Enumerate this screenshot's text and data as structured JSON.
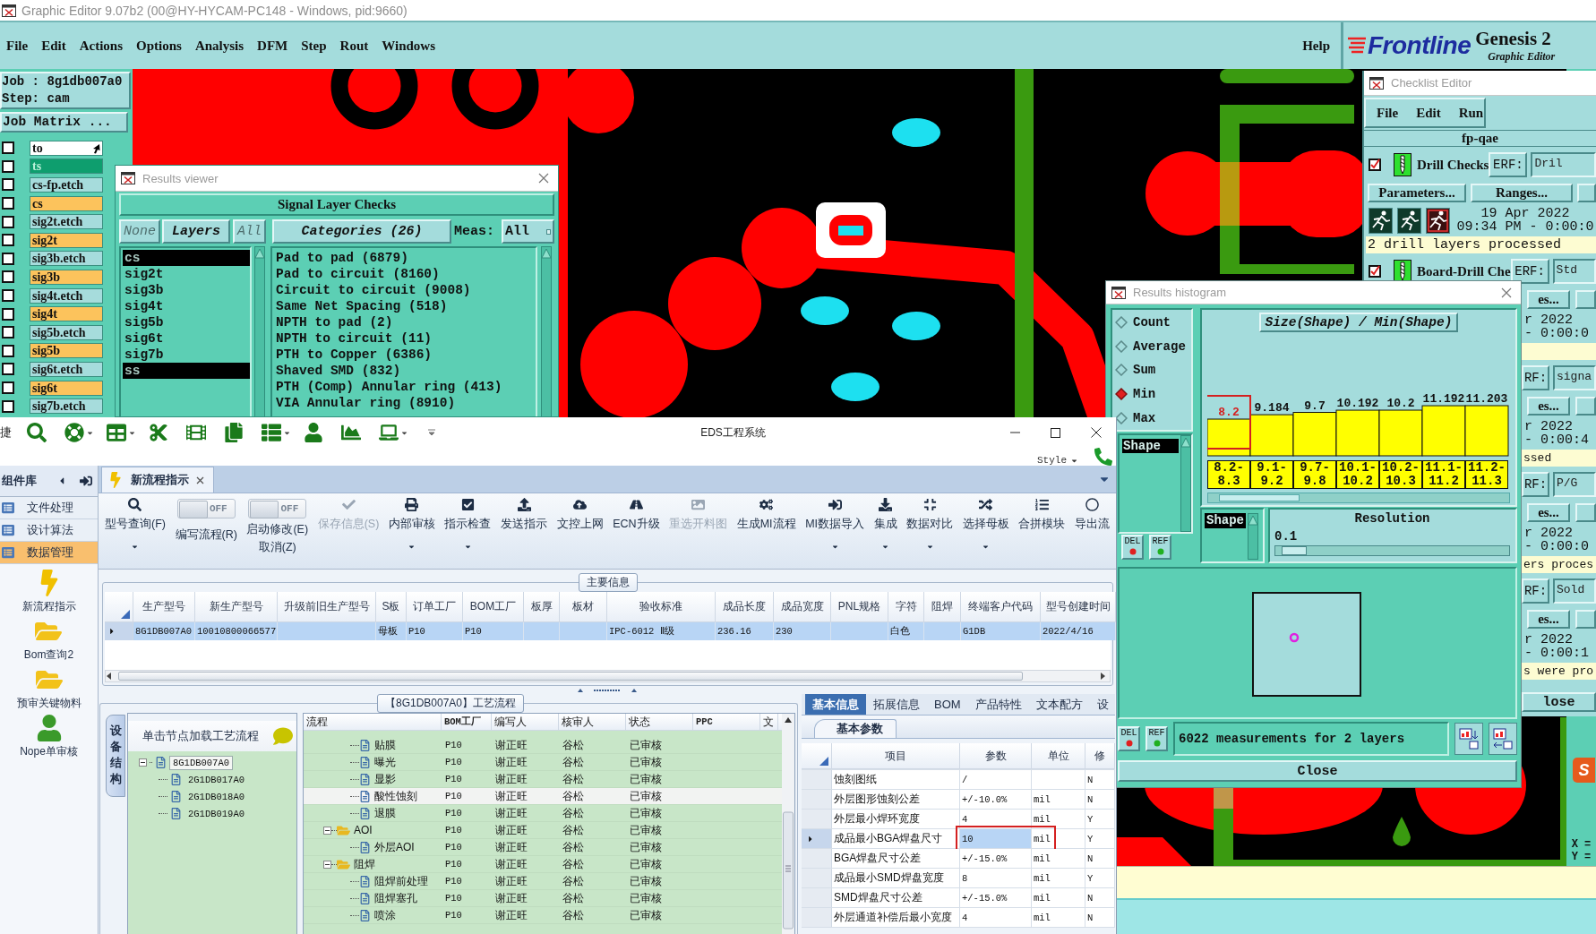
{
  "genesis": {
    "title": "Graphic Editor 9.07b2 (00@HY-HYCAM-PC148 - Windows, pid:9660)",
    "menu": [
      "File",
      "Edit",
      "Actions",
      "Options",
      "Analysis",
      "DFM",
      "Step",
      "Rout",
      "Windows"
    ],
    "help": "Help",
    "logo": {
      "brand": "Frontline",
      "product": "Genesis 2",
      "subtitle": "Graphic Editor"
    },
    "job": "Job : 8g1db007a0",
    "step": "Step: cam",
    "job_matrix": "Job Matrix ...",
    "layers": [
      {
        "name": "to",
        "color": "#ffffff",
        "checked": false,
        "pointer": true
      },
      {
        "name": "ts",
        "color": "#0e9e6e",
        "checked": false,
        "pointer": false
      },
      {
        "name": "cs-fp.etch",
        "color": "#a6dcdc",
        "checked": false,
        "pointer": false
      },
      {
        "name": "cs",
        "color": "#fcc35c",
        "checked": false,
        "pointer": false
      },
      {
        "name": "sig2t.etch",
        "color": "#a6dcdc",
        "checked": false,
        "pointer": false
      },
      {
        "name": "sig2t",
        "color": "#fcc35c",
        "checked": false,
        "pointer": false
      },
      {
        "name": "sig3b.etch",
        "color": "#a6dcdc",
        "checked": false,
        "pointer": false
      },
      {
        "name": "sig3b",
        "color": "#fcc35c",
        "checked": false,
        "pointer": false
      },
      {
        "name": "sig4t.etch",
        "color": "#a6dcdc",
        "checked": false,
        "pointer": false
      },
      {
        "name": "sig4t",
        "color": "#fcc35c",
        "checked": false,
        "pointer": false
      },
      {
        "name": "sig5b.etch",
        "color": "#a6dcdc",
        "checked": false,
        "pointer": false
      },
      {
        "name": "sig5b",
        "color": "#fcc35c",
        "checked": false,
        "pointer": false
      },
      {
        "name": "sig6t.etch",
        "color": "#a6dcdc",
        "checked": false,
        "pointer": false
      },
      {
        "name": "sig6t",
        "color": "#fcc35c",
        "checked": false,
        "pointer": false
      },
      {
        "name": "sig7b.etch",
        "color": "#a6dcdc",
        "checked": false,
        "pointer": false
      }
    ],
    "badge": "S",
    "coords": [
      "X =",
      "Y ="
    ]
  },
  "results_viewer": {
    "title": "Results viewer",
    "header": "Signal Layer Checks",
    "none": "None",
    "layers_title": "Layers",
    "all": "All",
    "categories_title": "Categories (26)",
    "meas_label": "Meas:",
    "meas_value": "All",
    "layers": [
      {
        "name": "cs",
        "selected": true
      },
      {
        "name": "sig2t",
        "selected": false
      },
      {
        "name": "sig3b",
        "selected": false
      },
      {
        "name": "sig4t",
        "selected": false
      },
      {
        "name": "sig5b",
        "selected": false
      },
      {
        "name": "sig6t",
        "selected": false
      },
      {
        "name": "sig7b",
        "selected": false
      },
      {
        "name": "ss",
        "selected": true
      }
    ],
    "categories": [
      {
        "label": "Pad to pad (6879)",
        "selected": false
      },
      {
        "label": "Pad to circuit (8160)",
        "selected": false
      },
      {
        "label": "Circuit to circuit (9008)",
        "selected": false
      },
      {
        "label": "Same Net Spacing (518)",
        "selected": false
      },
      {
        "label": "NPTH to pad (2)",
        "selected": false
      },
      {
        "label": "NPTH to circuit (11)",
        "selected": false
      },
      {
        "label": "PTH to Copper (6386)",
        "selected": false
      },
      {
        "label": "Shaved SMD (832)",
        "selected": false
      },
      {
        "label": "PTH (Comp) Annular ring (413)",
        "selected": false
      },
      {
        "label": "VIA Annular ring (8910)",
        "selected": false
      }
    ]
  },
  "checklist": {
    "title": "Checklist Editor",
    "menu": [
      "File",
      "Edit",
      "Run"
    ],
    "name": "fp-qae",
    "checks": [
      {
        "kind": "full",
        "checked": true,
        "name": "Drill Checks",
        "erf_label": "ERF:",
        "erf": "Dril",
        "parameters": "Parameters...",
        "ranges": "Ranges...",
        "date": "19 Apr 2022",
        "time": "09:34 PM - 0:00:0",
        "status": "2 drill layers processed"
      },
      {
        "kind": "header",
        "checked": true,
        "name": "Board-Drill Che",
        "erf_label": "ERF:",
        "erf": "Std",
        "ranges": "es...",
        "date": "r 2022",
        "time": "- 0:00:0"
      },
      {
        "kind": "strip",
        "erf_label": "RF:",
        "erf": "signa",
        "ranges": "es...",
        "date": "r 2022",
        "time": "- 0:00:4",
        "status": "ssed"
      },
      {
        "kind": "strip",
        "erf_label": "RF:",
        "erf": "P/G",
        "ranges": "es...",
        "date": "r 2022",
        "time": "- 0:00:0",
        "status": "ers proces"
      },
      {
        "kind": "strip",
        "erf_label": "RF:",
        "erf": "Sold",
        "ranges": "es...",
        "date": "r 2022",
        "time": "- 0:00:1",
        "status": "s were pro"
      }
    ],
    "close": "lose"
  },
  "histogram": {
    "title": "Results histogram",
    "modes": [
      {
        "label": "Count",
        "selected": false
      },
      {
        "label": "Average",
        "selected": false
      },
      {
        "label": "Sum",
        "selected": false
      },
      {
        "label": "Min",
        "selected": true
      },
      {
        "label": "Max",
        "selected": false
      }
    ],
    "fields": [
      {
        "label": "Shape",
        "selected": true
      }
    ],
    "top_buttons": [
      "DEL",
      "REF"
    ],
    "chart_data": {
      "type": "bar",
      "title": "Size(Shape) / Min(Shape)",
      "categories": [
        "8.2-8.3",
        "9.1-9.2",
        "9.7-9.8",
        "10.1-10.2",
        "10.2-10.3",
        "11.1-11.2",
        "11.2-11.3"
      ],
      "values": [
        8.2,
        9.184,
        9.7,
        10.192,
        10.2,
        11.192,
        11.203
      ],
      "data_labels": true
    },
    "bins": [
      {
        "highlighted": true
      },
      {
        "highlighted": false
      },
      {
        "highlighted": false
      },
      {
        "highlighted": false
      },
      {
        "highlighted": false
      },
      {
        "highlighted": false
      },
      {
        "highlighted": false
      }
    ],
    "field_label": "Shape",
    "resolution_label": "Resolution",
    "resolution": "0.1",
    "resolution_slider": {
      "level": 0.03
    },
    "bottom_buttons": [
      "DEL",
      "REF"
    ],
    "summary": "6022 measurements for 2 layers",
    "close": "Close"
  },
  "eds": {
    "quick_label": "捷",
    "title": "EDS工程系统",
    "style": "Style",
    "sidebar": {
      "title": "组件库",
      "groups": [
        {
          "label": "文件处理",
          "selected": false
        },
        {
          "label": "设计算法",
          "selected": false
        },
        {
          "label": "数据管理",
          "selected": true
        }
      ],
      "items": [
        {
          "label": "新流程指示"
        },
        {
          "label": "Bom查询2"
        },
        {
          "label": "预审关键物料"
        },
        {
          "label": "Nope单审核"
        }
      ]
    },
    "tabs": [
      {
        "label": "新流程指示",
        "selected": true
      }
    ],
    "ribbon": [
      {
        "kind": "button",
        "label": "型号查询(F)",
        "disabled": false,
        "dropdown": true
      },
      {
        "kind": "toggle",
        "toggle": "OFF",
        "on": false,
        "label": "编写流程(R)"
      },
      {
        "kind": "toggle",
        "toggle": "OFF",
        "on": false,
        "label": "启动修改(E)",
        "label2": "取消(Z)"
      },
      {
        "kind": "button",
        "label": "保存信息(S)",
        "disabled": true,
        "dropdown": false
      },
      {
        "kind": "button",
        "label": "内部审核",
        "disabled": false,
        "dropdown": true
      },
      {
        "kind": "button",
        "label": "指示检查",
        "disabled": false,
        "dropdown": true
      },
      {
        "kind": "button",
        "label": "发送指示",
        "disabled": false,
        "dropdown": false
      },
      {
        "kind": "button",
        "label": "文控上网",
        "disabled": false,
        "dropdown": false
      },
      {
        "kind": "button",
        "label": "ECN升级",
        "disabled": false,
        "dropdown": false
      },
      {
        "kind": "button",
        "label": "重选开料图",
        "disabled": true,
        "dropdown": false
      },
      {
        "kind": "button",
        "label": "生成MI流程",
        "disabled": false,
        "dropdown": false
      },
      {
        "kind": "button",
        "label": "MI数据导入",
        "disabled": false,
        "dropdown": true
      },
      {
        "kind": "button",
        "label": "集成",
        "disabled": false,
        "dropdown": true
      },
      {
        "kind": "button",
        "label": "数据对比",
        "disabled": false,
        "dropdown": true
      },
      {
        "kind": "button",
        "label": "选择母板",
        "disabled": false,
        "dropdown": true
      },
      {
        "kind": "button",
        "label": "合拼模块",
        "disabled": false,
        "dropdown": false
      },
      {
        "kind": "button",
        "label": "导出流",
        "disabled": false,
        "dropdown": false
      }
    ],
    "main_info": {
      "title": "主要信息",
      "columns": [
        "生产型号",
        "新生产型号",
        "升级前旧生产型号",
        "S板",
        "订单工厂",
        "BOM工厂",
        "板厚",
        "板材",
        "验收标准",
        "成品长度",
        "成品宽度",
        "PNL规格",
        "字符",
        "阻焊",
        "终端客户代码",
        "型号创建时间"
      ],
      "rows": [
        {
          "selected": true,
          "cells": [
            "8G1DB007A0",
            "10010800066577",
            null,
            "母板",
            "P10",
            "P10",
            null,
            null,
            "IPC-6012 Ⅱ级",
            "236.16",
            "230",
            null,
            "白色",
            null,
            "G1DB",
            "2022/4/16"
          ]
        }
      ]
    },
    "process": {
      "title": "【8G1DB007A0】工艺流程",
      "side_tab": "设备结构",
      "tree_header": "单击节点加载工艺流程",
      "tree": [
        {
          "label": "8G1DB007A0",
          "expanded": true,
          "selected": true,
          "children": [
            {
              "label": "2G1DB017A0",
              "selected": false
            },
            {
              "label": "2G1DB018A0",
              "selected": false
            },
            {
              "label": "2G1DB019A0",
              "selected": false
            }
          ]
        }
      ],
      "columns": [
        "流程",
        "BOM工厂",
        "编写人",
        "核审人",
        "状态",
        "PPC",
        "文"
      ],
      "rows": [
        {
          "children": [
            {
              "kind": "step",
              "label": "贴膜",
              "cells": [
                "P10",
                "谢正旺",
                "谷松",
                "已审核"
              ],
              "selected": false
            },
            {
              "kind": "step",
              "label": "曝光",
              "cells": [
                "P10",
                "谢正旺",
                "谷松",
                "已审核"
              ],
              "selected": false
            },
            {
              "kind": "step",
              "label": "显影",
              "cells": [
                "P10",
                "谢正旺",
                "谷松",
                "已审核"
              ],
              "selected": false
            },
            {
              "kind": "step",
              "label": "酸性蚀刻",
              "cells": [
                "P10",
                "谢正旺",
                "谷松",
                "已审核"
              ],
              "selected": true
            },
            {
              "kind": "step",
              "label": "退膜",
              "cells": [
                "P10",
                "谢正旺",
                "谷松",
                "已审核"
              ],
              "selected": false
            }
          ]
        },
        {
          "kind": "folder",
          "label": "AOI",
          "expanded": true,
          "selected": false,
          "cells": [
            "P10",
            "谢正旺",
            "谷松",
            "已审核"
          ],
          "children": [
            {
              "kind": "step",
              "label": "外层AOI",
              "cells": [
                "P10",
                "谢正旺",
                "谷松",
                "已审核"
              ],
              "selected": false
            }
          ]
        },
        {
          "kind": "folder",
          "label": "阻焊",
          "expanded": true,
          "selected": false,
          "cells": [
            "P10",
            "谢正旺",
            "谷松",
            "已审核"
          ],
          "children": [
            {
              "kind": "step",
              "label": "阻焊前处理",
              "cells": [
                "P10",
                "谢正旺",
                "谷松",
                "已审核"
              ],
              "selected": false
            },
            {
              "kind": "step",
              "label": "阻焊塞孔",
              "cells": [
                "P10",
                "谢正旺",
                "谷松",
                "已审核"
              ],
              "selected": false
            },
            {
              "kind": "step",
              "label": "喷涂",
              "cells": [
                "P10",
                "谢正旺",
                "谷松",
                "已审核"
              ],
              "selected": false
            }
          ]
        }
      ]
    },
    "params": {
      "tabs": [
        {
          "label": "基本信息",
          "selected": true
        },
        {
          "label": "拓展信息",
          "selected": false
        },
        {
          "label": "BOM",
          "selected": false
        },
        {
          "label": "产品特性",
          "selected": false
        },
        {
          "label": "文本配方",
          "selected": false
        },
        {
          "label": "设",
          "selected": false
        }
      ],
      "subtab": "基本参数",
      "columns": [
        "项目",
        "参数",
        "单位",
        "修"
      ],
      "rows": [
        {
          "cells": [
            "蚀刻图纸",
            "/",
            null,
            "N"
          ],
          "selected": false,
          "highlighted": false
        },
        {
          "cells": [
            "外层图形蚀刻公差",
            "+/-10.0%",
            "mil",
            "N"
          ],
          "selected": false,
          "highlighted": false
        },
        {
          "cells": [
            "外层最小焊环宽度",
            "4",
            "mil",
            "Y"
          ],
          "selected": false,
          "highlighted": false
        },
        {
          "cells": [
            "成品最小BGA焊盘尺寸",
            "10",
            "mil",
            "Y"
          ],
          "selected": true,
          "highlighted": true
        },
        {
          "cells": [
            "BGA焊盘尺寸公差",
            "+/-15.0%",
            "mil",
            "N"
          ],
          "selected": false,
          "highlighted": false
        },
        {
          "cells": [
            "成品最小SMD焊盘宽度",
            "8",
            "mil",
            "Y"
          ],
          "selected": false,
          "highlighted": false
        },
        {
          "cells": [
            "SMD焊盘尺寸公差",
            "+/-15.0%",
            "mil",
            "N"
          ],
          "selected": false,
          "highlighted": false
        },
        {
          "cells": [
            "外层通道补偿后最小宽度",
            "4",
            "mil",
            "N"
          ],
          "selected": false,
          "highlighted": false
        }
      ]
    }
  }
}
